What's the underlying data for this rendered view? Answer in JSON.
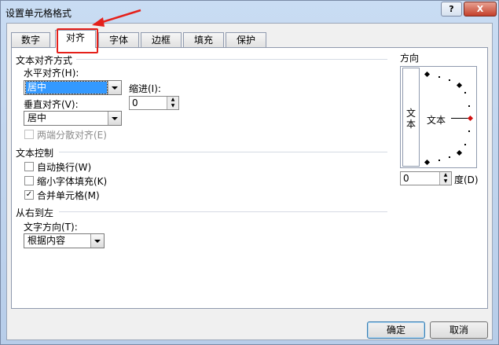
{
  "window": {
    "title": "设置单元格格式",
    "help_label": "?",
    "close_label": "X"
  },
  "tabs": [
    {
      "label": "数字",
      "active": false
    },
    {
      "label": "对齐",
      "active": true
    },
    {
      "label": "字体",
      "active": false
    },
    {
      "label": "边框",
      "active": false
    },
    {
      "label": "填充",
      "active": false
    },
    {
      "label": "保护",
      "active": false
    }
  ],
  "alignment": {
    "section_title": "文本对齐方式",
    "horizontal_label": "水平对齐(H):",
    "horizontal_value": "居中",
    "indent_label": "缩进(I):",
    "indent_value": "0",
    "vertical_label": "垂直对齐(V):",
    "vertical_value": "居中",
    "justify_distributed_label": "两端分散对齐(E)"
  },
  "text_control": {
    "section_title": "文本控制",
    "wrap_text_label": "自动换行(W)",
    "wrap_text_checked": false,
    "shrink_to_fit_label": "缩小字体填充(K)",
    "shrink_to_fit_checked": false,
    "merge_cells_label": "合并单元格(M)",
    "merge_cells_checked": true
  },
  "rtl": {
    "section_title": "从右到左",
    "direction_label": "文字方向(T):",
    "direction_value": "根据内容"
  },
  "orientation": {
    "title": "方向",
    "vertical_text": "文本",
    "dial_text": "文本",
    "degrees_value": "0",
    "degrees_label": "度(D)"
  },
  "buttons": {
    "ok_label": "确定",
    "cancel_label": "取消"
  },
  "colors": {
    "highlight": "#e5201a",
    "selection": "#3399ff",
    "title_bg": "#c9dcf3"
  }
}
